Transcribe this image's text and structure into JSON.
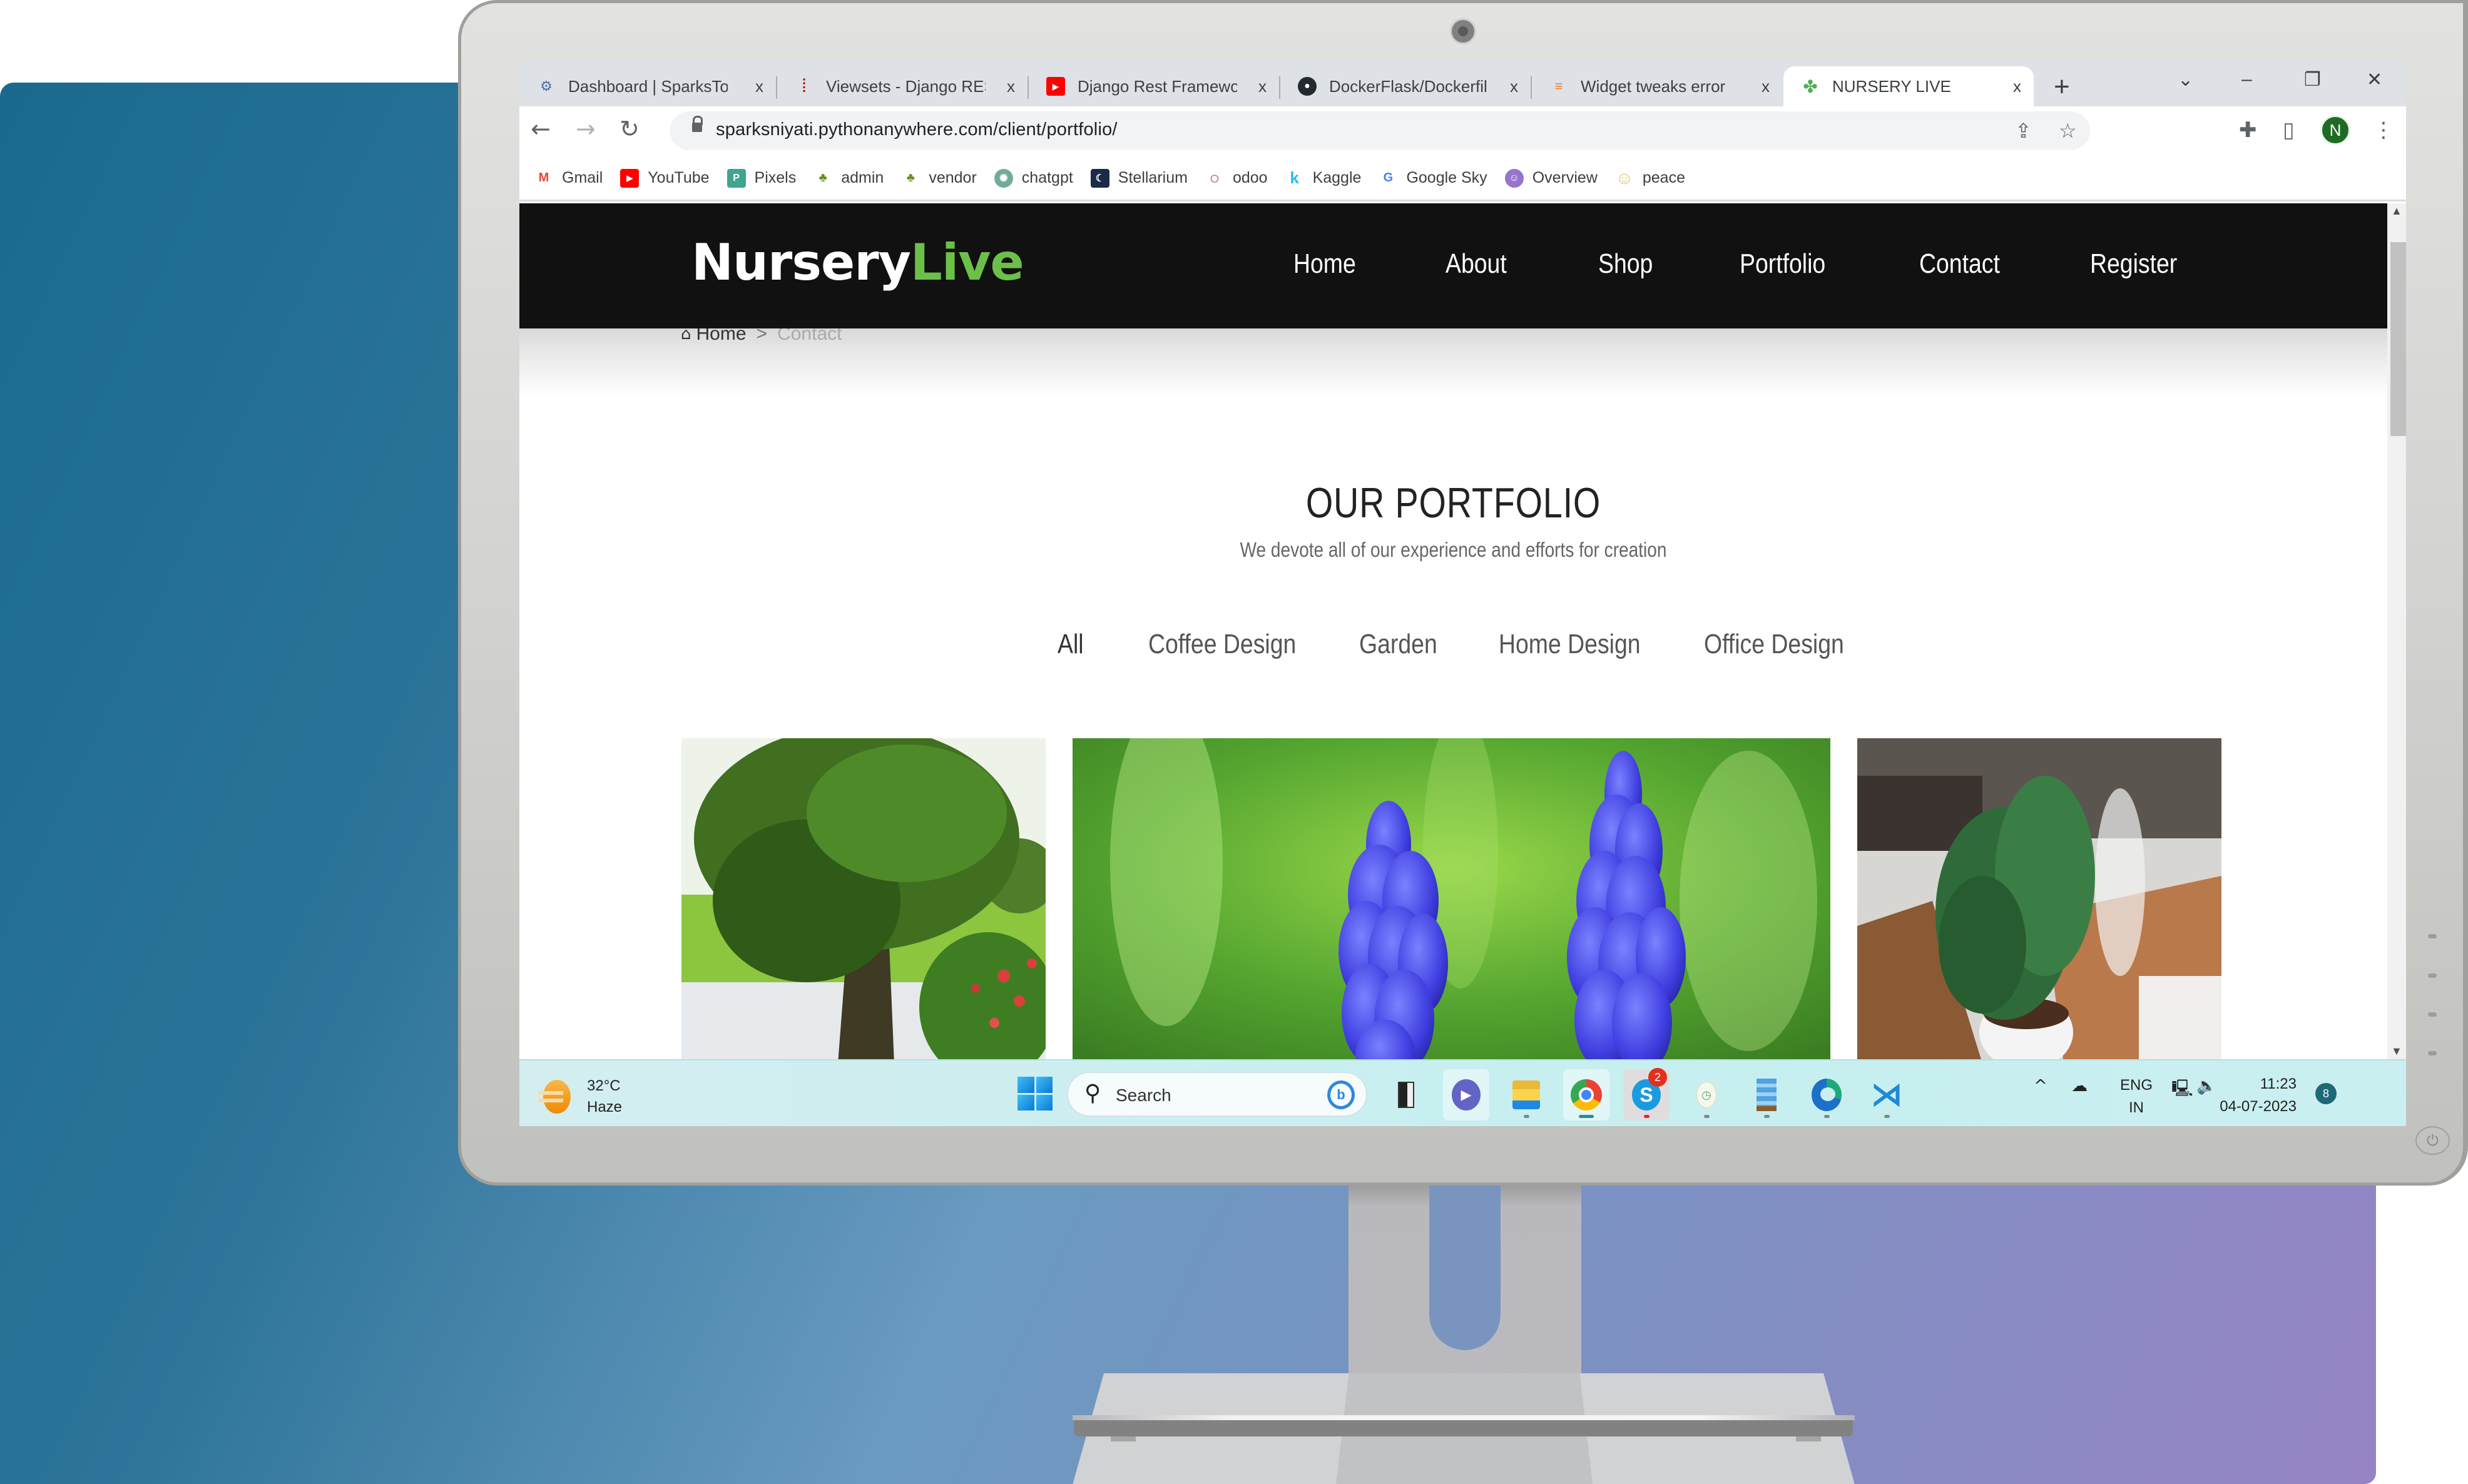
{
  "browser": {
    "tabs": [
      {
        "title": "Dashboard | SparksTo",
        "favicon": "sparkstoro-icon"
      },
      {
        "title": "Viewsets - Django RES",
        "favicon": "django-rest-icon"
      },
      {
        "title": "Django Rest Framewo",
        "favicon": "youtube-icon"
      },
      {
        "title": "DockerFlask/Dockerfil",
        "favicon": "github-icon"
      },
      {
        "title": "Widget tweaks error",
        "favicon": "stackoverflow-icon"
      },
      {
        "title": "NURSERY LIVE",
        "favicon": "nursery-leaf-icon",
        "active": true
      }
    ],
    "close_glyph": "x",
    "new_tab_glyph": "+",
    "window_controls": {
      "tab_search": "⌄",
      "minimize": "–",
      "restore": "❐",
      "close": "✕"
    },
    "nav": {
      "back": "←",
      "forward": "→",
      "reload": "↻"
    },
    "url": "sparksniyati.pythonanywhere.com/client/portfolio/",
    "profile_initial": "N",
    "bookmarks": [
      {
        "label": "Gmail",
        "icon": "gmail-icon"
      },
      {
        "label": "YouTube",
        "icon": "youtube-icon"
      },
      {
        "label": "Pixels",
        "icon": "pixels-icon"
      },
      {
        "label": "admin",
        "icon": "admin-icon"
      },
      {
        "label": "vendor",
        "icon": "vendor-icon"
      },
      {
        "label": "chatgpt",
        "icon": "chatgpt-icon"
      },
      {
        "label": "Stellarium",
        "icon": "stellarium-icon"
      },
      {
        "label": "odoo",
        "icon": "odoo-icon"
      },
      {
        "label": "Kaggle",
        "icon": "kaggle-icon"
      },
      {
        "label": "Google Sky",
        "icon": "google-icon"
      },
      {
        "label": "Overview",
        "icon": "overview-icon"
      },
      {
        "label": "peace",
        "icon": "peace-icon"
      }
    ]
  },
  "site": {
    "logo": {
      "main": "Nursery",
      "accent": "Live"
    },
    "accent_color": "#6cc04a",
    "menu": [
      "Home",
      "About",
      "Shop",
      "Portfolio",
      "Contact",
      "Register"
    ],
    "breadcrumb": {
      "home": "Home",
      "separator": ">",
      "current": "Contact"
    },
    "title": "OUR PORTFOLIO",
    "subtitle": "We devote all of our experience and efforts for creation",
    "filters": [
      "All",
      "Coffee Design",
      "Garden",
      "Home Design",
      "Office Design"
    ],
    "photos": [
      {
        "alt": "Tree beside a pond in a garden"
      },
      {
        "alt": "Blue grape hyacinth flowers"
      },
      {
        "alt": "Potted green plant on a table"
      }
    ]
  },
  "taskbar": {
    "weather": {
      "temp": "32°C",
      "condition": "Haze"
    },
    "search_placeholder": "Search",
    "apps": [
      {
        "name": "task-view"
      },
      {
        "name": "teams-meet"
      },
      {
        "name": "file-explorer"
      },
      {
        "name": "chrome",
        "active": true
      },
      {
        "name": "skype",
        "badge": "2"
      },
      {
        "name": "clock-app"
      },
      {
        "name": "notepad"
      },
      {
        "name": "edge"
      },
      {
        "name": "vscode"
      }
    ],
    "language": {
      "line1": "ENG",
      "line2": "IN"
    },
    "time": "11:23",
    "date": "04-07-2023",
    "notification_count": "8"
  }
}
